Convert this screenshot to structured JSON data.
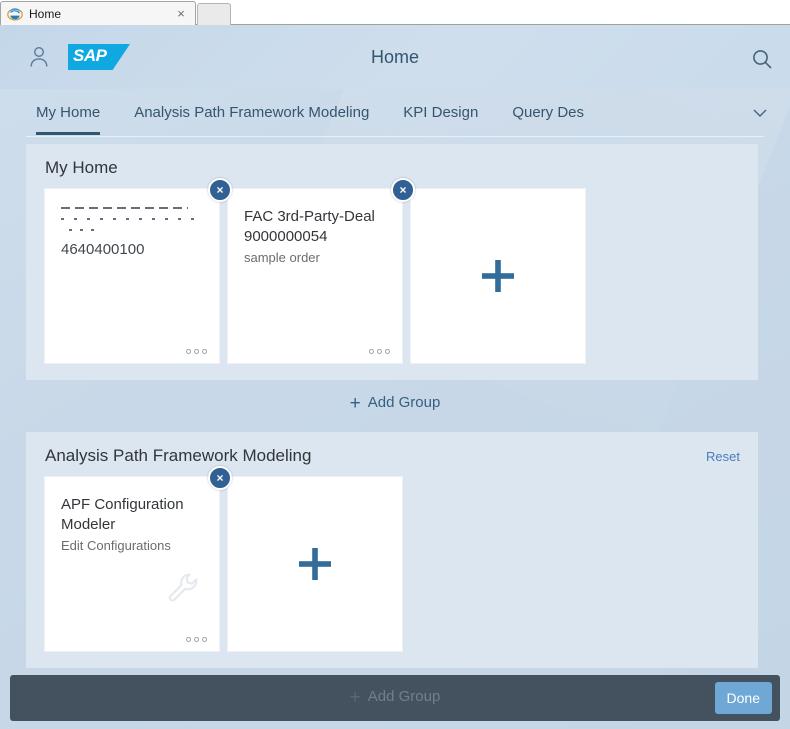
{
  "browser": {
    "tab_title": "Home",
    "close_label": "×",
    "ie_icon": "internet-explorer-icon"
  },
  "header": {
    "title": "Home",
    "user_icon": "user-icon",
    "logo_text": "SAP",
    "search_icon": "search-icon"
  },
  "navigation": {
    "tabs": [
      {
        "label": "My Home",
        "selected": true
      },
      {
        "label": "Analysis Path Framework Modeling",
        "selected": false
      },
      {
        "label": "KPI Design",
        "selected": false
      },
      {
        "label": "Query Des",
        "selected": false
      }
    ],
    "overflow_icon": "chevron-down-icon"
  },
  "groups": [
    {
      "title": "My Home",
      "reset_label": "",
      "tiles": [
        {
          "title": "",
          "title_state": "partially-rendered",
          "subtitle": "",
          "number": "4640400100",
          "remove_label": "×",
          "actions_icon": "more-actions-icon"
        },
        {
          "title": "FAC 3rd-Party-Deal 9000000054",
          "subtitle": "sample order",
          "number": "",
          "remove_label": "×",
          "actions_icon": "more-actions-icon"
        }
      ],
      "add_tile_icon": "plus-icon"
    },
    {
      "title": "Analysis Path Framework Modeling",
      "reset_label": "Reset",
      "tiles": [
        {
          "title": "APF Configuration Modeler",
          "subtitle": "Edit Configurations",
          "number": "",
          "deco_icon": "wrench-icon",
          "remove_label": "×",
          "actions_icon": "more-actions-icon"
        }
      ],
      "add_tile_icon": "plus-icon"
    }
  ],
  "add_group": {
    "label": "Add Group",
    "icon": "plus-icon"
  },
  "footer": {
    "add_group_label": "Add Group",
    "add_group_icon": "plus-icon",
    "done_label": "Done"
  },
  "colors": {
    "brand_blue": "#10a8e0",
    "header_text": "#33566f",
    "tile_bg": "#ffffff",
    "group_bg": "#dce6f0",
    "page_bg": "#c8d8e8",
    "footer_bg": "#44515e",
    "done_button_bg": "#6fa8d4",
    "remove_badge_bg": "#316094",
    "reset_link": "#4b7fb5"
  }
}
